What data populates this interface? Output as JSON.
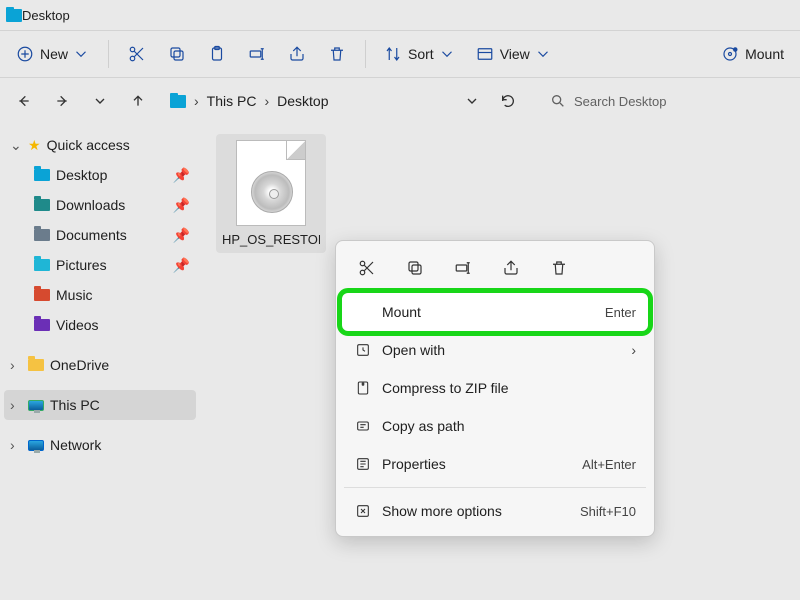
{
  "title": "Desktop",
  "toolbar": {
    "new_label": "New",
    "sort_label": "Sort",
    "view_label": "View",
    "mount_label": "Mount"
  },
  "breadcrumb": {
    "root": "This PC",
    "leaf": "Desktop"
  },
  "search": {
    "placeholder": "Search Desktop"
  },
  "sidebar": {
    "quick_access": "Quick access",
    "items": [
      {
        "label": "Desktop",
        "pinned": true
      },
      {
        "label": "Downloads",
        "pinned": true
      },
      {
        "label": "Documents",
        "pinned": true
      },
      {
        "label": "Pictures",
        "pinned": true
      },
      {
        "label": "Music",
        "pinned": false
      },
      {
        "label": "Videos",
        "pinned": false
      }
    ],
    "onedrive": "OneDrive",
    "this_pc": "This PC",
    "network": "Network"
  },
  "file": {
    "name": "HP_OS_RESTORE"
  },
  "context_menu": {
    "mount": {
      "label": "Mount",
      "shortcut": "Enter"
    },
    "open_with": {
      "label": "Open with"
    },
    "compress": {
      "label": "Compress to ZIP file"
    },
    "copy_path": {
      "label": "Copy as path"
    },
    "properties": {
      "label": "Properties",
      "shortcut": "Alt+Enter"
    },
    "more_options": {
      "label": "Show more options",
      "shortcut": "Shift+F10"
    }
  }
}
